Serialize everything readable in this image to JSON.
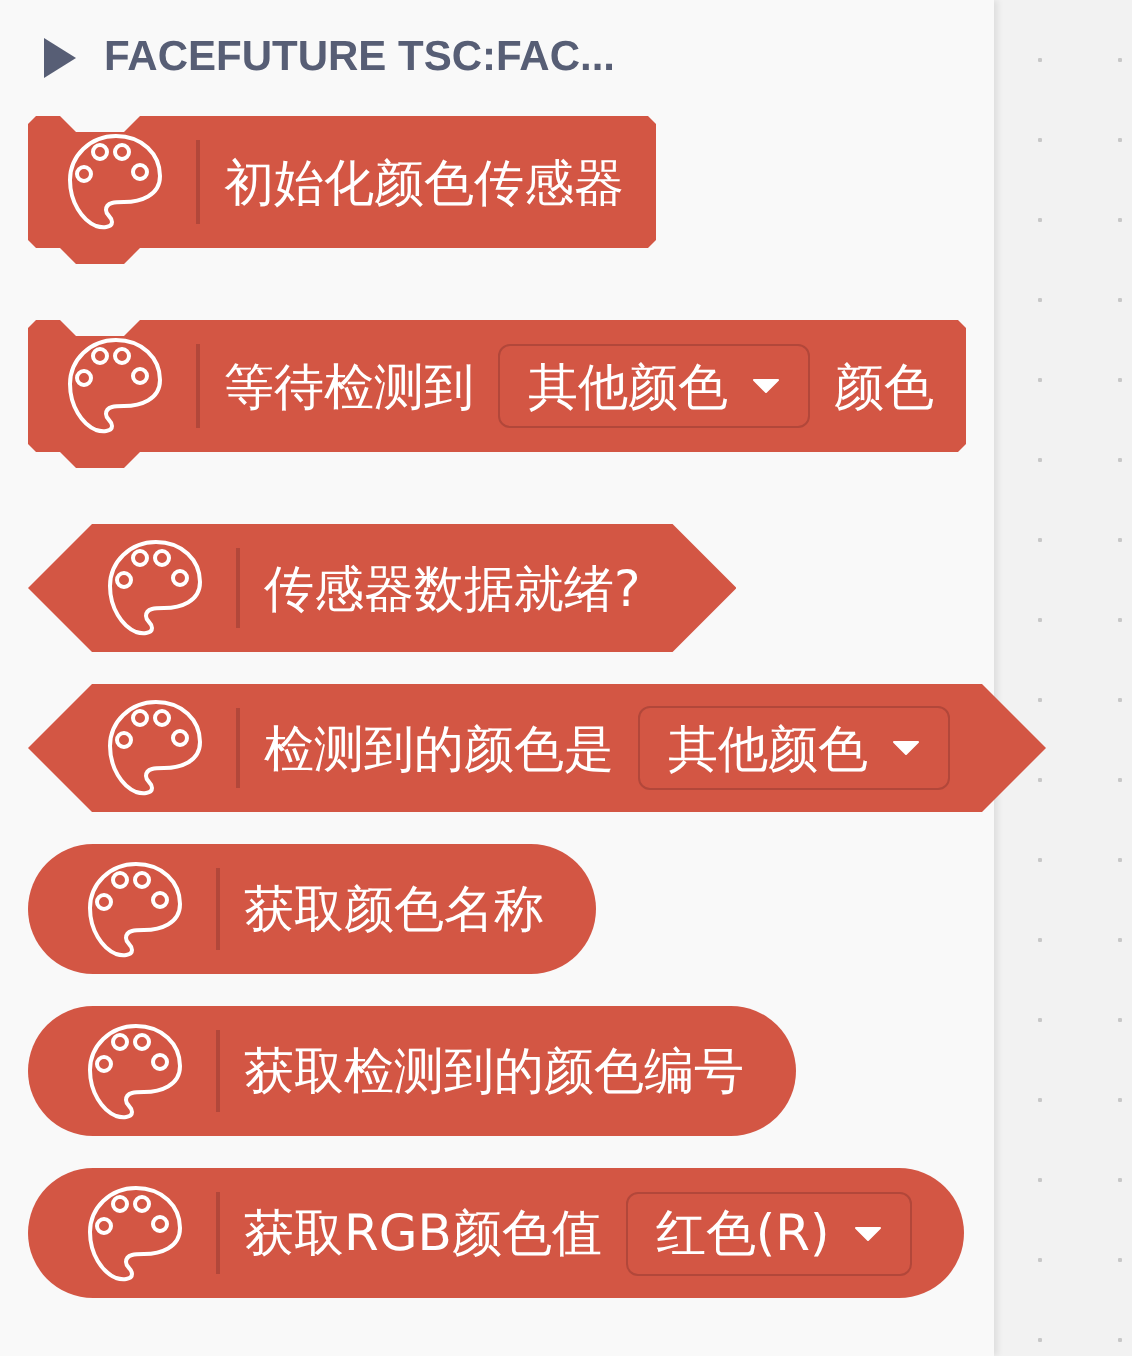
{
  "category": {
    "title": "FACEFUTURE TSC:FAC...",
    "expanded": false
  },
  "blocks": [
    {
      "kind": "command",
      "parts": [
        {
          "kind": "text",
          "text": "初始化颜色传感器"
        }
      ]
    },
    {
      "kind": "command",
      "parts": [
        {
          "kind": "text",
          "text": "等待检测到"
        },
        {
          "kind": "dropdown",
          "text": "其他颜色"
        },
        {
          "kind": "text",
          "text": "颜色"
        }
      ]
    },
    {
      "kind": "boolean",
      "parts": [
        {
          "kind": "text",
          "text": "传感器数据就绪?"
        }
      ]
    },
    {
      "kind": "boolean",
      "parts": [
        {
          "kind": "text",
          "text": "检测到的颜色是"
        },
        {
          "kind": "dropdown",
          "text": "其他颜色"
        }
      ]
    },
    {
      "kind": "reporter",
      "parts": [
        {
          "kind": "text",
          "text": "获取颜色名称"
        }
      ]
    },
    {
      "kind": "reporter",
      "parts": [
        {
          "kind": "text",
          "text": "获取检测到的颜色编号"
        }
      ]
    },
    {
      "kind": "reporter",
      "parts": [
        {
          "kind": "text",
          "text": "获取RGB颜色值"
        },
        {
          "kind": "dropdown",
          "text": "红色(R)"
        }
      ]
    }
  ]
}
